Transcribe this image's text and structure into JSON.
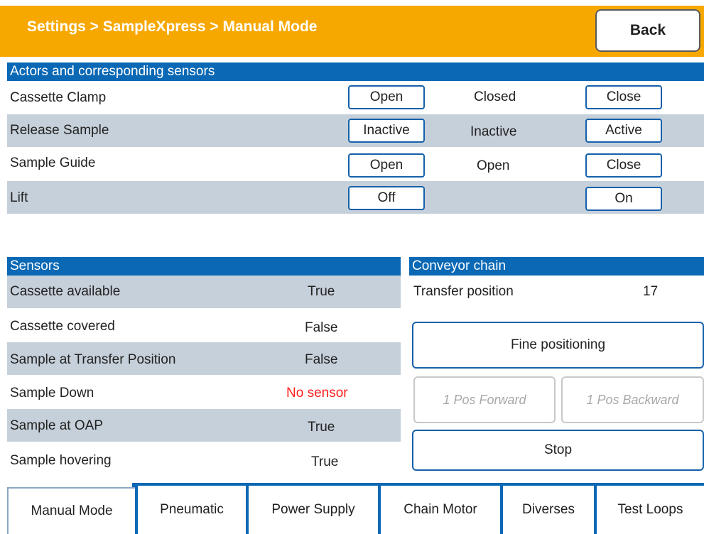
{
  "header": {
    "breadcrumb": "Settings > SampleXpress > Manual Mode",
    "back_label": "Back"
  },
  "actors": {
    "title": "Actors and corresponding sensors",
    "rows": [
      {
        "name": "Cassette Clamp",
        "btn1": "Open",
        "status": "Closed",
        "btn2": "Close"
      },
      {
        "name": "Release Sample",
        "btn1": "Inactive",
        "status": "Inactive",
        "btn2": "Active"
      },
      {
        "name": "Sample Guide",
        "btn1": "Open",
        "status": "Open",
        "btn2": "Close"
      },
      {
        "name": "Lift",
        "btn1": "Off",
        "status": "",
        "btn2": "On"
      }
    ]
  },
  "sensors": {
    "title": "Sensors",
    "rows": [
      {
        "name": "Cassette available",
        "value": "True"
      },
      {
        "name": "Cassette covered",
        "value": "False"
      },
      {
        "name": "Sample at Transfer Position",
        "value": "False"
      },
      {
        "name": "Sample Down",
        "value": "No sensor"
      },
      {
        "name": "Sample at OAP",
        "value": "True"
      },
      {
        "name": "Sample hovering",
        "value": "True"
      }
    ]
  },
  "conveyor": {
    "title": "Conveyor chain",
    "transfer_label": "Transfer position",
    "transfer_value": "17",
    "fine_label": "Fine positioning",
    "forward_label": "1 Pos Forward",
    "backward_label": "1 Pos Backward",
    "stop_label": "Stop"
  },
  "tabs": [
    "Manual Mode",
    "Pneumatic",
    "Power Supply",
    "Chain Motor",
    "Diverses",
    "Test Loops"
  ],
  "colors": {
    "header": "#f7a800",
    "section_header": "#0a68b5",
    "row_shade": "#c6d0da",
    "warning_text": "#ff1e1e"
  }
}
